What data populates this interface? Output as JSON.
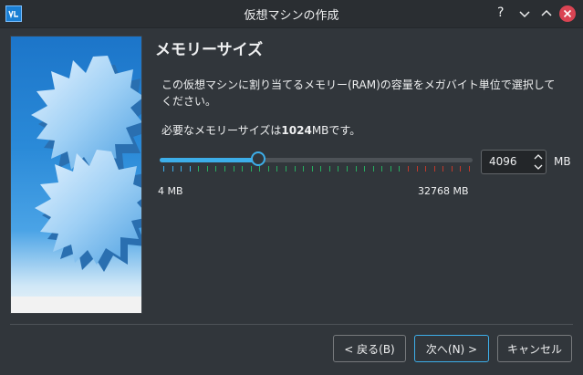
{
  "window": {
    "title": "仮想マシンの作成"
  },
  "titlebar": {
    "help_glyph": "?",
    "minimize_glyph": "⌄",
    "maximize_glyph": "⌃",
    "close_glyph": "✕"
  },
  "page": {
    "heading": "メモリーサイズ",
    "description": "この仮想マシンに割り当てるメモリー(RAM)の容量をメガバイト単位で選択してください。",
    "recommended_prefix": "必要なメモリーサイズは",
    "recommended_value": "1024",
    "recommended_suffix": "MBです。"
  },
  "memory": {
    "slider_min_label": "4 MB",
    "slider_max_label": "32768 MB",
    "min_value": 4,
    "max_value": 32768,
    "current_value": 4096,
    "value_display": "4096",
    "unit": "MB"
  },
  "buttons": {
    "back": "< 戻る(B)",
    "next": "次へ(N) >",
    "cancel": "キャンセル"
  },
  "colors": {
    "accent": "#3daee9",
    "tick_green": "#27ae60",
    "tick_red": "#c0392b",
    "close": "#da4453"
  }
}
